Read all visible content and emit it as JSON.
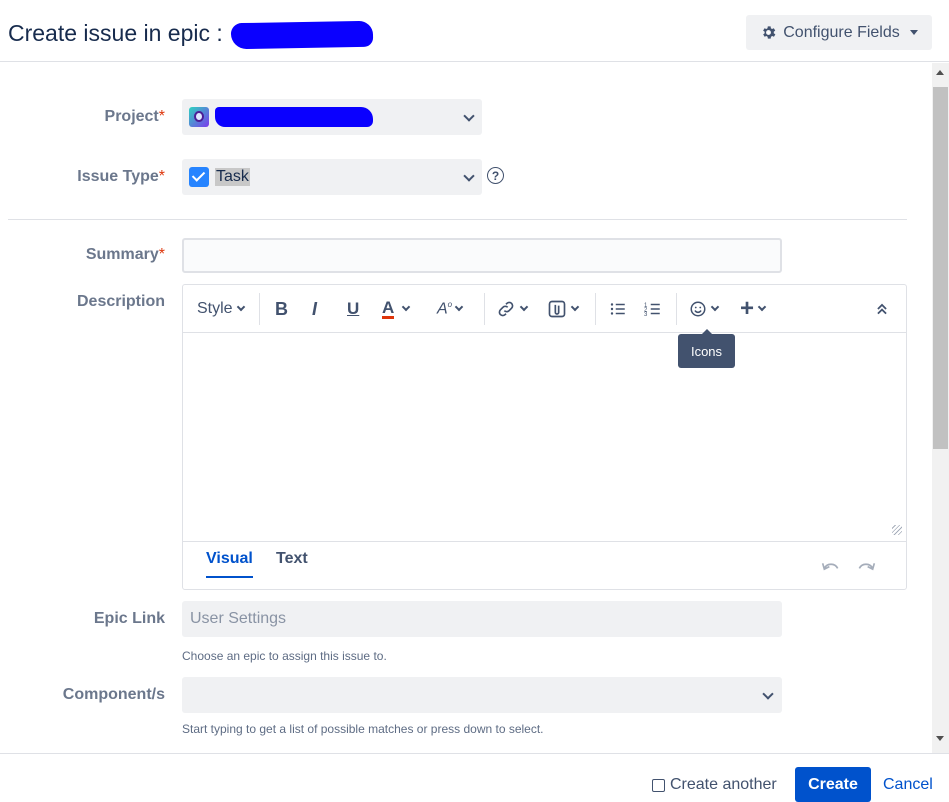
{
  "header": {
    "title": "Create issue in epic :",
    "configure_label": "Configure Fields"
  },
  "form": {
    "project_label": "Project",
    "issue_type_label": "Issue Type",
    "issue_type_value": "Task",
    "summary_label": "Summary",
    "description_label": "Description",
    "epic_link_label": "Epic Link",
    "epic_link_placeholder": "User Settings",
    "epic_link_hint": "Choose an epic to assign this issue to.",
    "component_label": "Component/s",
    "component_hint": "Start typing to get a list of possible matches or press down to select.",
    "required_marker": "*"
  },
  "editor": {
    "style_label": "Style",
    "tooltip": "Icons",
    "tab_visual": "Visual",
    "tab_text": "Text",
    "toolbar_icons": [
      "bold-icon",
      "italic-icon",
      "underline-icon",
      "text-color-icon",
      "more-formatting-icon",
      "link-icon",
      "attachment-icon",
      "bullet-list-icon",
      "numbered-list-icon",
      "emoji-icon",
      "insert-icon",
      "collapse-icon"
    ],
    "accent_color": "#de350b"
  },
  "footer": {
    "create_another_label": "Create another",
    "create_label": "Create",
    "cancel_label": "Cancel"
  },
  "colors": {
    "primary": "#0052cc",
    "required": "#de350b",
    "redaction": "#0a00ff"
  }
}
